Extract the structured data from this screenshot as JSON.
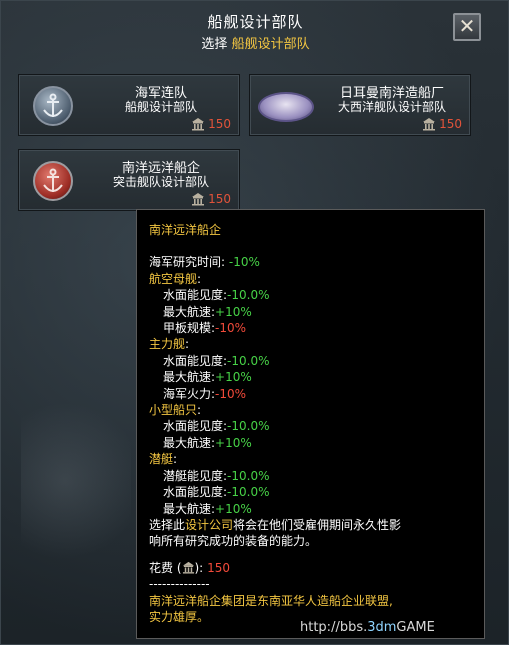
{
  "header": {
    "title": "船舰设计部队",
    "subtitle_prefix": "选择",
    "subtitle_accent": "船舰设计部队",
    "close_icon": "close-x-icon"
  },
  "cards": [
    {
      "title": "海军连队",
      "subtitle": "船舰设计部队",
      "cost": "150",
      "emblem": "anchor-icon"
    },
    {
      "title": "日耳曼南洋造船厂",
      "subtitle": "大西洋舰队设计部队",
      "cost": "150",
      "emblem": "seal-badge-icon"
    },
    {
      "title": "南洋远洋船企",
      "subtitle": "突击舰队设计部队",
      "cost": "150",
      "emblem": "anchor-red-icon"
    }
  ],
  "tooltip": {
    "title": "南洋远洋船企",
    "naval_research_label": "海军研究时间:",
    "naval_research_value": "-10%",
    "carrier": {
      "header": "航空母舰",
      "rows": [
        {
          "label": "水面能见度:",
          "value": "-10.0%",
          "tone": "green"
        },
        {
          "label": "最大航速:",
          "value": "+10%",
          "tone": "green"
        },
        {
          "label": "甲板规模:",
          "value": "-10%",
          "tone": "red"
        }
      ]
    },
    "capital": {
      "header": "主力舰",
      "rows": [
        {
          "label": "水面能见度:",
          "value": "-10.0%",
          "tone": "green"
        },
        {
          "label": "最大航速:",
          "value": "+10%",
          "tone": "green"
        },
        {
          "label": "海军火力:",
          "value": "-10%",
          "tone": "red"
        }
      ]
    },
    "screen": {
      "header": "小型船只",
      "rows": [
        {
          "label": "水面能见度:",
          "value": "-10.0%",
          "tone": "green"
        },
        {
          "label": "最大航速:",
          "value": "+10%",
          "tone": "green"
        }
      ]
    },
    "submarine": {
      "header": "潜艇",
      "rows": [
        {
          "label": "潜艇能见度:",
          "value": "-10.0%",
          "tone": "green"
        },
        {
          "label": "水面能见度:",
          "value": "-10.0%",
          "tone": "green"
        },
        {
          "label": "最大航速:",
          "value": "+10%",
          "tone": "green"
        }
      ]
    },
    "desc_part1": "选择此",
    "desc_accent": "设计公司",
    "desc_part2": "将会在他们受雇佣期间永久性影",
    "desc_line2": "响所有研究成功的装备的能力。",
    "cost_label": "花费 (",
    "cost_label_end": "):",
    "cost_value": "150",
    "divider": "--------------",
    "flavor_line1": "南洋远洋船企集团是东南亚华人造船企业联盟,",
    "flavor_line2": "实力雄厚。"
  },
  "watermark": {
    "prefix": "http://bbs.",
    "mid": "3dm",
    "suffix": "GAME"
  }
}
